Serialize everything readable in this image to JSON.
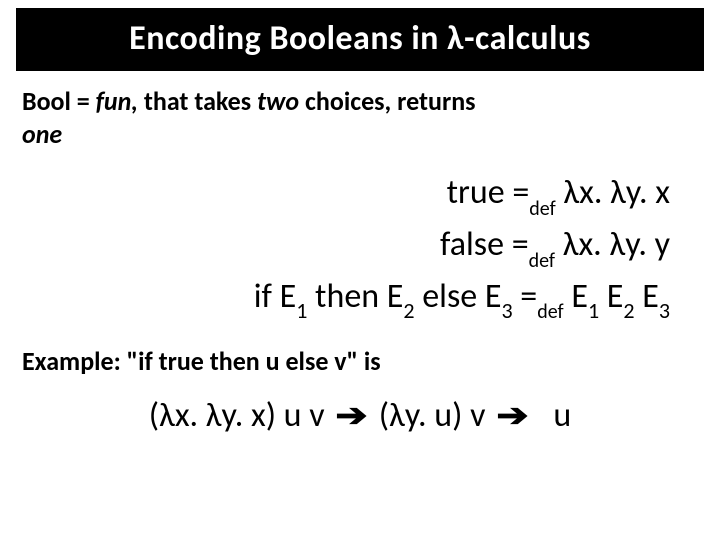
{
  "title": "Encoding Booleans in λ-calculus",
  "para1": {
    "prefix": "Bool = ",
    "fun": "fun,",
    "mid1": " that takes ",
    "two": "two",
    "mid2": " choices, returns ",
    "one": "one"
  },
  "defs": {
    "true_lhs": "true =",
    "true_sub": "def",
    "true_rhs": " λx. λy. x",
    "false_lhs": "false =",
    "false_sub": "def",
    "false_rhs": " λx. λy. y",
    "if_pre": "if E",
    "s1": "1",
    "if_then": " then E",
    "s2": "2",
    "if_else": " else E",
    "s3": "3",
    "if_eq": " =",
    "if_sub": "def",
    "if_rhs_e1": " E",
    "if_rhs_e2": " E",
    "if_rhs_e3": " E"
  },
  "example": {
    "label_pre": "Example: \"if ",
    "label_true": "true",
    "label_mid1": " then ",
    "label_u": "u",
    "label_mid2": " else ",
    "label_v": "v",
    "label_post": "\" is"
  },
  "reduction": {
    "step1": "(λx. λy. x) u v",
    "arrow": "➔",
    "step2": "(λy. u) v",
    "step3": "u"
  }
}
